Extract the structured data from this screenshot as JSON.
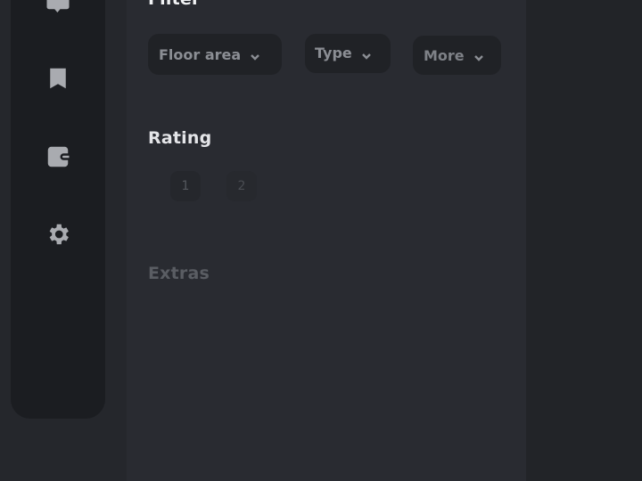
{
  "sidebar": {
    "icons": [
      "chat-icon",
      "bookmark-icon",
      "wallet-icon",
      "gear-icon"
    ]
  },
  "filter": {
    "title": "Filter",
    "chips": [
      {
        "label": "Floor area"
      },
      {
        "label": "Type"
      },
      {
        "label": "More"
      }
    ]
  },
  "rating": {
    "title": "Rating",
    "options": [
      "1",
      "2"
    ]
  },
  "extras": {
    "title": "Extras"
  }
}
